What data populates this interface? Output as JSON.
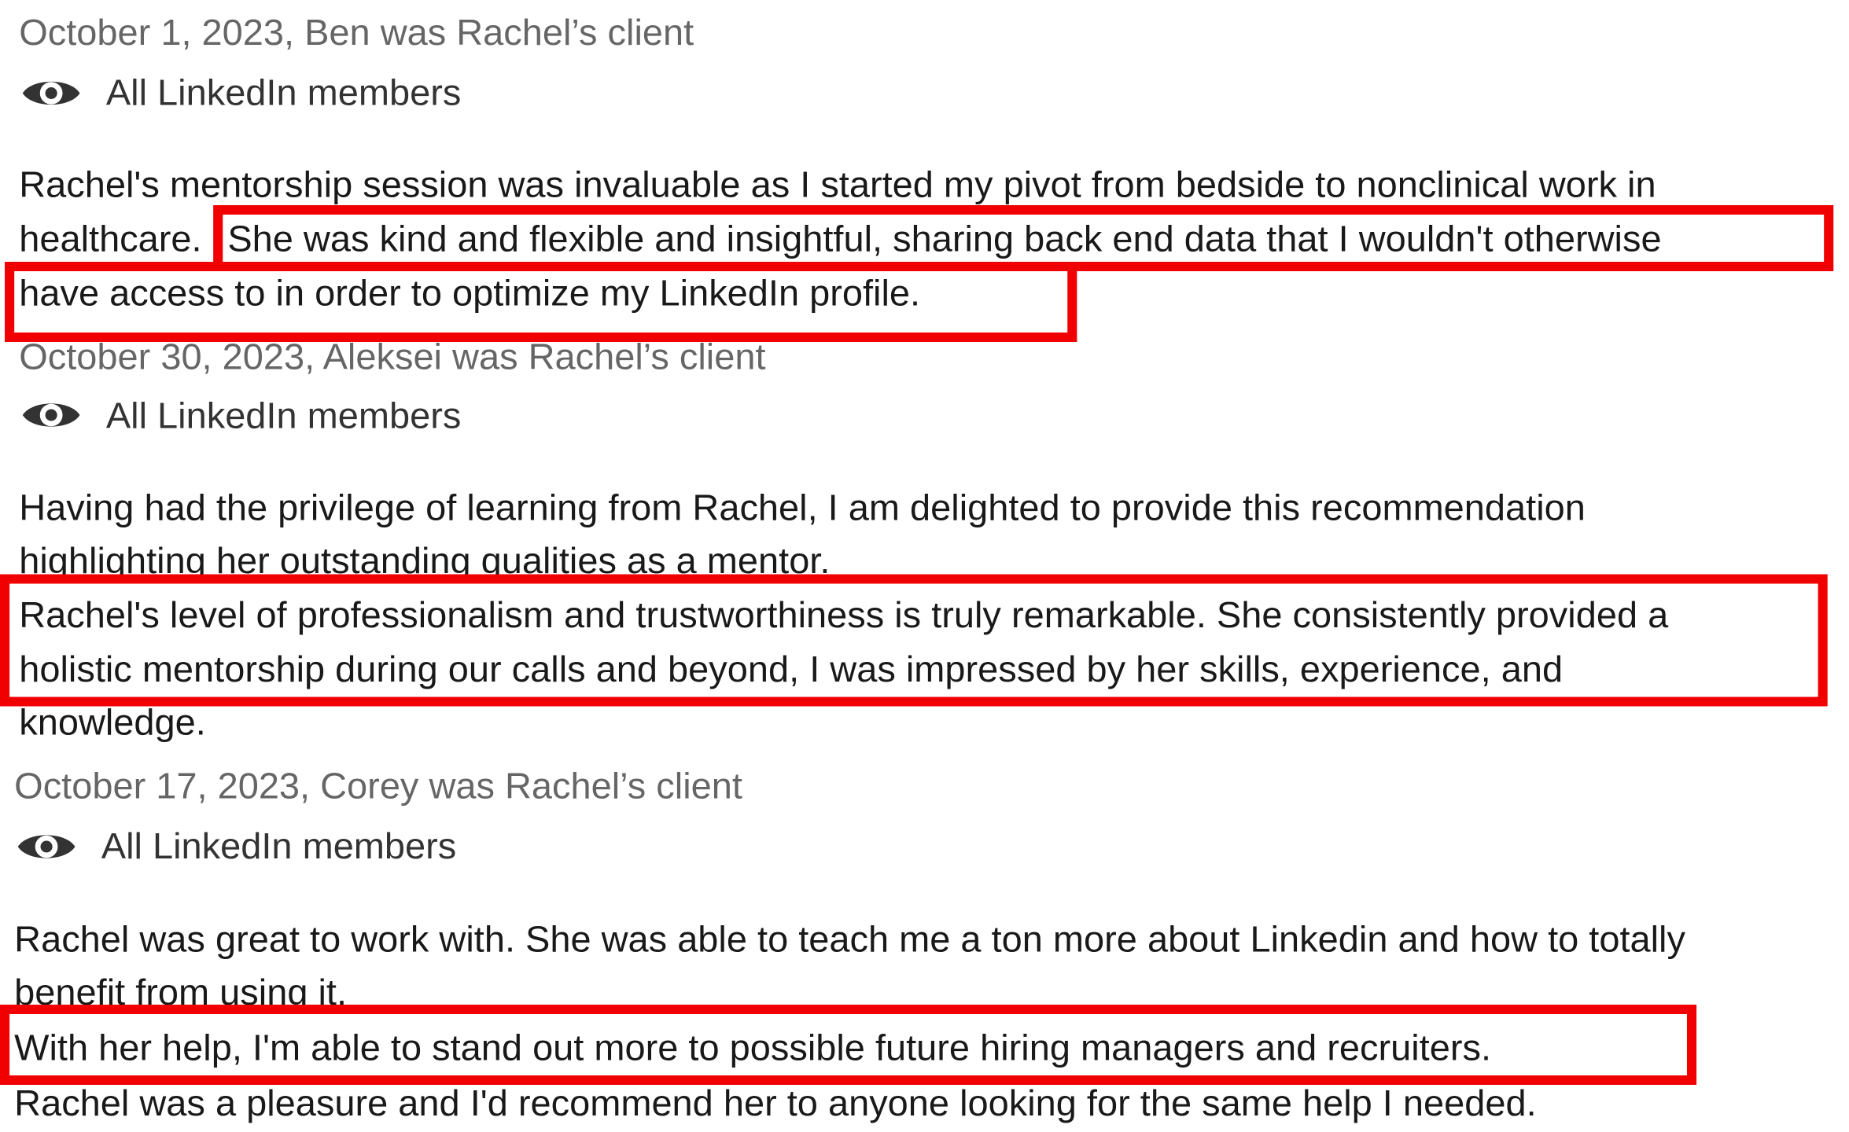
{
  "recommendations": [
    {
      "meta": "October 1, 2023, Ben was Rachel’s client",
      "visibility": {
        "label": "All LinkedIn members",
        "icon": "eye-icon"
      },
      "lines": [
        "Rachel's mentorship session was invaluable as I started my pivot from bedside to nonclinical work in",
        "healthcare.",
        "She was kind and flexible and insightful, sharing back end data that I wouldn't otherwise",
        "have access to in order to optimize my LinkedIn profile."
      ]
    },
    {
      "meta": "October 30, 2023, Aleksei was Rachel’s client",
      "visibility": {
        "label": "All LinkedIn members",
        "icon": "eye-icon"
      },
      "lines": [
        "Having had the privilege of learning from Rachel, I am delighted to provide this recommendation",
        "highlighting her outstanding qualities as a mentor.",
        "Rachel's level of professionalism and trustworthiness is truly remarkable. She consistently provided a",
        "holistic mentorship during our calls and beyond, I was impressed by her skills, experience, and",
        "knowledge."
      ]
    },
    {
      "meta": "October 17, 2023, Corey was Rachel’s client",
      "visibility": {
        "label": "All LinkedIn members",
        "icon": "eye-icon"
      },
      "lines": [
        "Rachel was great to work with. She was able to teach me a ton more about Linkedin and how to totally",
        "benefit from using it.",
        "With her help, I'm able to stand out more to possible future hiring managers and recruiters.",
        "Rachel was a pleasure and I'd recommend her to anyone looking for the same help I needed."
      ]
    }
  ],
  "colors": {
    "highlight": "#f00000",
    "meta_text": "#666666",
    "body_text": "#191919"
  }
}
